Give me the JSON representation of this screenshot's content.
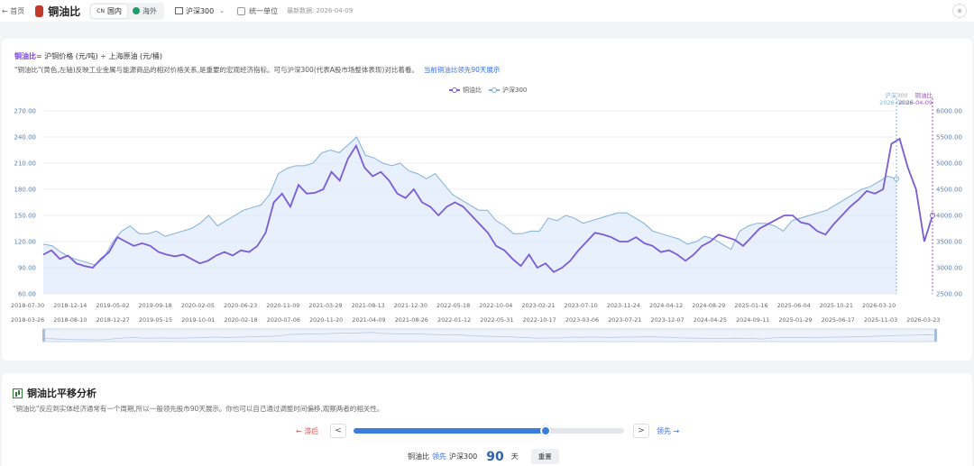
{
  "topbar": {
    "back": "← 首页",
    "title": "铜油比",
    "tabs": [
      {
        "flag": "CN",
        "label": "国内"
      },
      {
        "label": "海外"
      }
    ],
    "index_select": "沪深300",
    "unify_units": "统一单位",
    "updated_label": "最新数据:",
    "updated_date": "2026-04-09",
    "theme_icon": "✳"
  },
  "main": {
    "formula_hl": "铜油比",
    "formula_rest": " = 沪铜价格 (元/吨) ÷ 上海原油 (元/桶)",
    "description": "\"铜油比\"(黄色,左轴)反映工业金属与能源商品的相对价格关系,是重要的宏观经济指标。可与沪深300(代表A股市场整体表现)对比着看。",
    "lead_note": "当前铜油比领先90天展示"
  },
  "chart_data": {
    "type": "line",
    "title": "",
    "legend_position": "top-center",
    "grid": true,
    "series": [
      {
        "name": "铜油比",
        "axis": "left",
        "color": "#7b5bd6",
        "values": [
          105,
          110,
          100,
          104,
          95,
          92,
          90,
          100,
          108,
          125,
          120,
          115,
          118,
          115,
          108,
          105,
          103,
          105,
          100,
          95,
          98,
          104,
          108,
          104,
          110,
          108,
          115,
          130,
          165,
          175,
          160,
          185,
          175,
          176,
          180,
          200,
          190,
          215,
          230,
          205,
          195,
          200,
          190,
          175,
          170,
          180,
          165,
          160,
          150,
          160,
          165,
          160,
          150,
          140,
          130,
          115,
          110,
          100,
          92,
          105,
          90,
          95,
          85,
          90,
          98,
          110,
          120,
          130,
          128,
          125,
          120,
          120,
          125,
          118,
          115,
          108,
          110,
          105,
          98,
          105,
          115,
          120,
          128,
          125,
          122,
          115,
          125,
          135,
          140,
          145,
          150,
          150,
          142,
          140,
          132,
          128,
          140,
          150,
          160,
          168,
          178,
          175,
          180,
          232,
          238,
          205,
          180,
          120,
          150
        ]
      },
      {
        "name": "沪深300",
        "axis": "right",
        "color": "#7fb0da",
        "values": [
          3450,
          3420,
          3300,
          3200,
          3150,
          3100,
          3050,
          3200,
          3500,
          3700,
          3800,
          3650,
          3650,
          3700,
          3600,
          3650,
          3700,
          3750,
          3850,
          4000,
          3800,
          3900,
          4000,
          4100,
          4150,
          4200,
          4400,
          4800,
          4900,
          4950,
          4950,
          5000,
          5200,
          5250,
          5200,
          5350,
          5500,
          5150,
          5100,
          5000,
          4950,
          5000,
          4850,
          4800,
          4700,
          4800,
          4600,
          4400,
          4300,
          4200,
          4100,
          4100,
          3900,
          3800,
          3650,
          3650,
          3700,
          3700,
          3950,
          3900,
          4000,
          3950,
          3850,
          3900,
          3950,
          4000,
          4050,
          4050,
          3950,
          3850,
          3700,
          3650,
          3600,
          3550,
          3450,
          3500,
          3600,
          3550,
          3450,
          3350,
          3700,
          3800,
          3850,
          3850,
          3800,
          3700,
          3900,
          3950,
          4000,
          4050,
          4100,
          4200,
          4300,
          4400,
          4500,
          4550,
          4650,
          4750,
          4700
        ]
      }
    ],
    "left_axis": {
      "min": 60,
      "max": 270,
      "ticks": [
        "60.00",
        "90.00",
        "120.00",
        "150.00",
        "180.00",
        "210.00",
        "240.00",
        "270.00"
      ]
    },
    "right_axis": {
      "min": 2500,
      "max": 6000,
      "ticks": [
        "2500.00",
        "3000.00",
        "3500.00",
        "4000.00",
        "4500.00",
        "5000.00",
        "5500.00",
        "6000.00"
      ]
    },
    "x_ticks_top": [
      "2018-07-30",
      "2018-12-14",
      "2019-05-02",
      "2019-09-18",
      "2020-02-05",
      "2020-06-23",
      "2020-11-09",
      "2021-03-29",
      "2021-08-13",
      "2021-12-30",
      "2022-05-18",
      "2022-10-04",
      "2023-02-21",
      "2023-07-10",
      "2023-11-24",
      "2024-04-12",
      "2024-08-29",
      "2025-01-16",
      "2025-06-04",
      "2025-10-21",
      "2026-03-10"
    ],
    "x_ticks_bottom": [
      "2018-03-26",
      "2018-08-10",
      "2018-12-27",
      "2019-05-15",
      "2019-10-01",
      "2020-02-18",
      "2020-07-06",
      "2020-11-20",
      "2021-04-09",
      "2021-08-26",
      "2022-01-12",
      "2022-05-31",
      "2022-10-17",
      "2023-03-06",
      "2023-07-21",
      "2023-12-07",
      "2024-04-25",
      "2024-09-11",
      "2025-01-29",
      "2025-06-17",
      "2025-11-03",
      "2026-03-23"
    ],
    "markers": [
      {
        "label": "沪深300",
        "date": "2026-04-09",
        "color": "#7fb0da"
      },
      {
        "label": "铜油比",
        "date": "2026-04-09",
        "color": "#9b59b6"
      }
    ]
  },
  "shift": {
    "title": "铜油比平移分析",
    "desc": "\"铜油比\"反应到实体经济通常有一个周期,所以一般领先股市90天展示。你也可以自己通过调整时间偏移,观察两者的相关性。",
    "lag_label": "← 滞后",
    "lead_label": "领先 →",
    "prev": "<",
    "next": ">",
    "slider_value": 0.71,
    "summary_prefix": "铜油比",
    "summary_lead": "领先",
    "summary_index": "沪深300",
    "days_value": "90",
    "days_unit": "天",
    "reset": "重置"
  }
}
